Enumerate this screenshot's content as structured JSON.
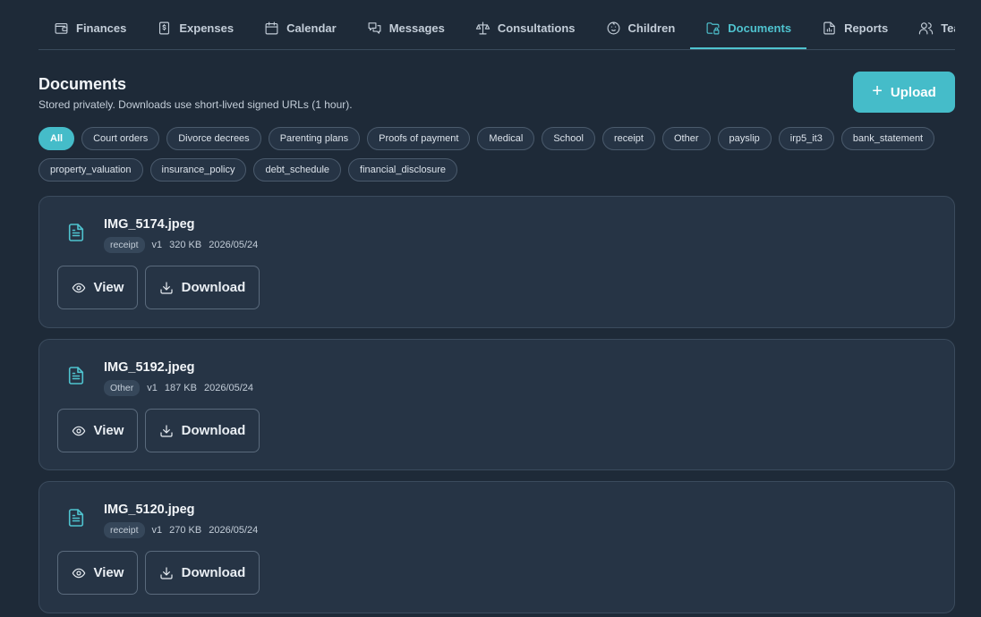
{
  "tabs": [
    {
      "label": "Finances",
      "icon": "wallet-icon"
    },
    {
      "label": "Expenses",
      "icon": "receipt-dollar-icon"
    },
    {
      "label": "Calendar",
      "icon": "calendar-icon"
    },
    {
      "label": "Messages",
      "icon": "messages-icon"
    },
    {
      "label": "Consultations",
      "icon": "scales-icon"
    },
    {
      "label": "Children",
      "icon": "baby-icon"
    },
    {
      "label": "Documents",
      "icon": "folder-lock-icon",
      "active": true
    },
    {
      "label": "Reports",
      "icon": "file-chart-icon"
    },
    {
      "label": "Team",
      "icon": "users-icon"
    },
    {
      "label": "",
      "icon": "file-check-icon"
    }
  ],
  "header": {
    "title": "Documents",
    "subtitle": "Stored privately. Downloads use short-lived signed URLs (1 hour).",
    "upload_label": "Upload",
    "upload_icon": "plus-icon"
  },
  "filters": [
    "All",
    "Court orders",
    "Divorce decrees",
    "Parenting plans",
    "Proofs of payment",
    "Medical",
    "School",
    "receipt",
    "Other",
    "payslip",
    "irp5_it3",
    "bank_statement",
    "property_valuation",
    "insurance_policy",
    "debt_schedule",
    "financial_disclosure"
  ],
  "active_filter": "All",
  "documents": [
    {
      "name": "IMG_5174.jpeg",
      "tag": "receipt",
      "version": "v1",
      "size": "320 KB",
      "date": "2026/05/24"
    },
    {
      "name": "IMG_5192.jpeg",
      "tag": "Other",
      "version": "v1",
      "size": "187 KB",
      "date": "2026/05/24"
    },
    {
      "name": "IMG_5120.jpeg",
      "tag": "receipt",
      "version": "v1",
      "size": "270 KB",
      "date": "2026/05/24"
    }
  ],
  "actions": {
    "view_label": "View",
    "download_label": "Download"
  },
  "colors": {
    "background": "#1e2a38",
    "card": "#263445",
    "accent": "#45bcc9"
  }
}
